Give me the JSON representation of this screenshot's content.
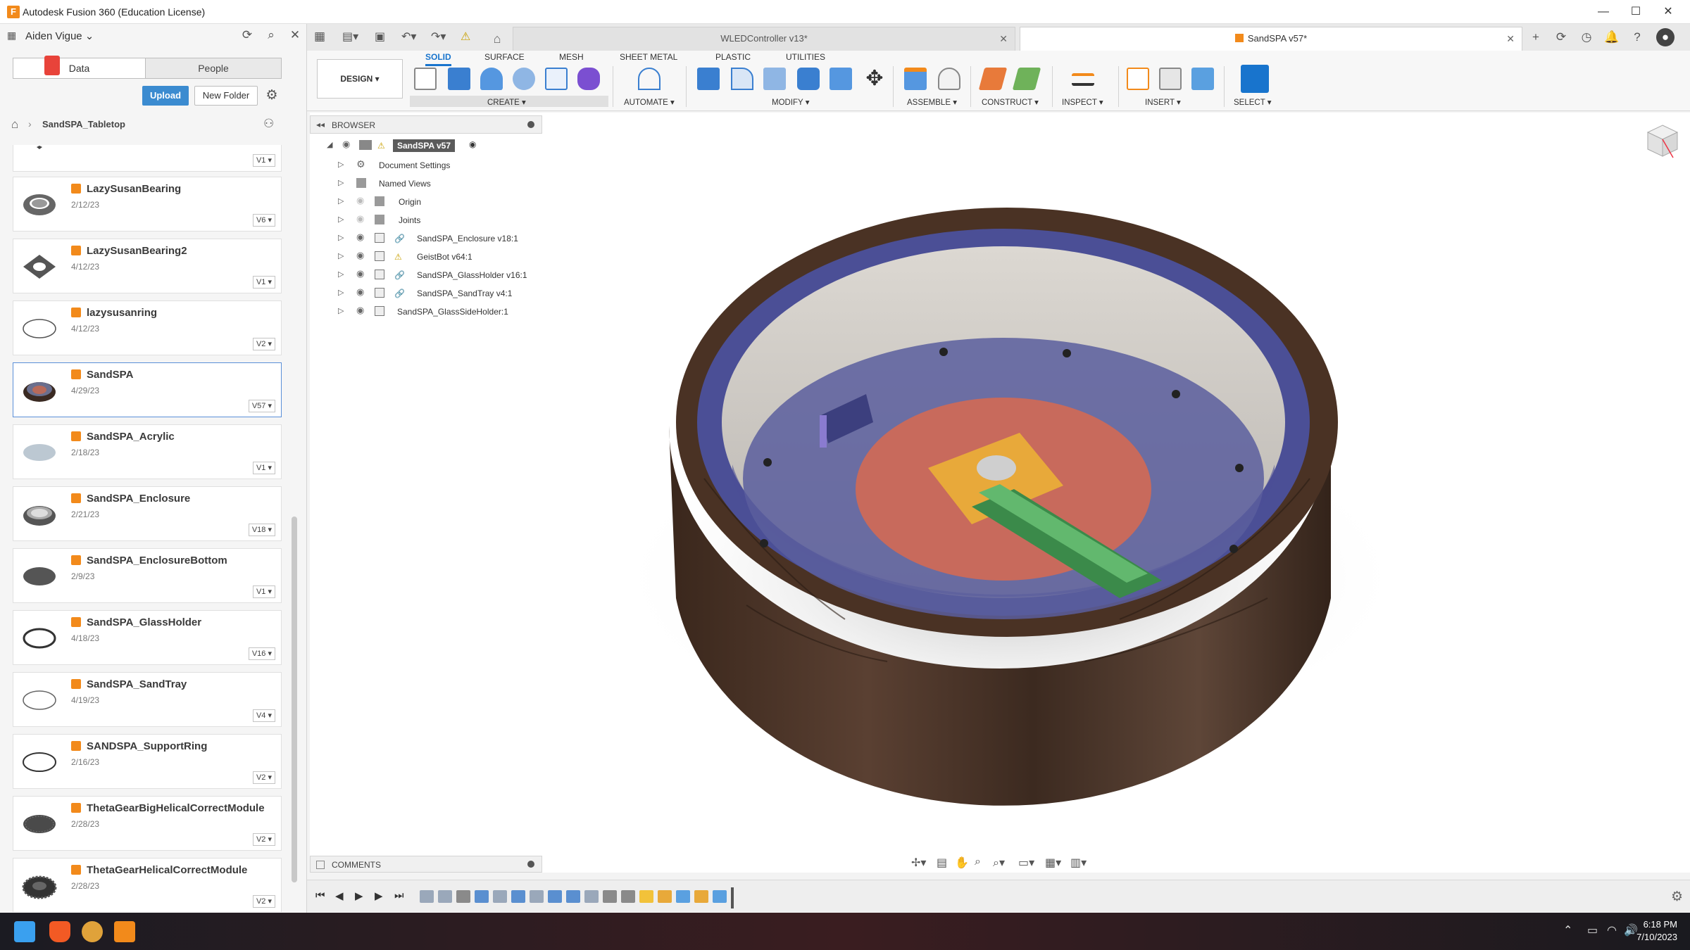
{
  "window": {
    "title": "Autodesk Fusion 360 (Education License)"
  },
  "datapanel": {
    "user": "Aiden Vigue",
    "tabs": {
      "data": "Data",
      "people": "People"
    },
    "upload_label": "Upload",
    "new_folder_label": "New Folder",
    "breadcrumb": "SandSPA_Tabletop",
    "files": [
      {
        "name": "",
        "date": "",
        "version": "V1 ▾"
      },
      {
        "name": "LazySusanBearing",
        "date": "2/12/23",
        "version": "V6 ▾"
      },
      {
        "name": "LazySusanBearing2",
        "date": "4/12/23",
        "version": "V1 ▾"
      },
      {
        "name": "lazysusanring",
        "date": "4/12/23",
        "version": "V2 ▾"
      },
      {
        "name": "SandSPA",
        "date": "4/29/23",
        "version": "V57 ▾"
      },
      {
        "name": "SandSPA_Acrylic",
        "date": "2/18/23",
        "version": "V1 ▾"
      },
      {
        "name": "SandSPA_Enclosure",
        "date": "2/21/23",
        "version": "V18 ▾"
      },
      {
        "name": "SandSPA_EnclosureBottom",
        "date": "2/9/23",
        "version": "V1 ▾"
      },
      {
        "name": "SandSPA_GlassHolder",
        "date": "4/18/23",
        "version": "V16 ▾"
      },
      {
        "name": "SandSPA_SandTray",
        "date": "4/19/23",
        "version": "V4 ▾"
      },
      {
        "name": "SANDSPA_SupportRing",
        "date": "2/16/23",
        "version": "V2 ▾"
      },
      {
        "name": "ThetaGearBigHelicalCorrectModule",
        "date": "2/28/23",
        "version": "V2 ▾"
      },
      {
        "name": "ThetaGearHelicalCorrectModule",
        "date": "2/28/23",
        "version": "V2 ▾"
      }
    ]
  },
  "doc_tabs": {
    "wled": "WLEDController v13*",
    "sandspa": "SandSPA v57*"
  },
  "ribbon": {
    "tabs": [
      "SOLID",
      "SURFACE",
      "MESH",
      "SHEET METAL",
      "PLASTIC",
      "UTILITIES"
    ],
    "workspace": "DESIGN ▾",
    "groups": {
      "create": "CREATE ▾",
      "automate": "AUTOMATE ▾",
      "modify": "MODIFY ▾",
      "assemble": "ASSEMBLE ▾",
      "construct": "CONSTRUCT ▾",
      "inspect": "INSPECT ▾",
      "insert": "INSERT ▾",
      "select": "SELECT ▾"
    }
  },
  "browser": {
    "title": "BROWSER",
    "root": "SandSPA v57",
    "items": [
      "Document Settings",
      "Named Views",
      "Origin",
      "Joints",
      "SandSPA_Enclosure v18:1",
      "GeistBot v64:1",
      "SandSPA_GlassHolder v16:1",
      "SandSPA_SandTray v4:1",
      "SandSPA_GlassSideHolder:1"
    ]
  },
  "comments": {
    "title": "COMMENTS"
  },
  "taskbar": {
    "time": "6:18 PM",
    "date": "7/10/2023"
  },
  "colors": {
    "accent": "#1874cd",
    "fusion_orange": "#f28a1b",
    "wood": "#4a3224",
    "tray_blue": "#4b4f96",
    "red_plate": "#c86a5c"
  }
}
